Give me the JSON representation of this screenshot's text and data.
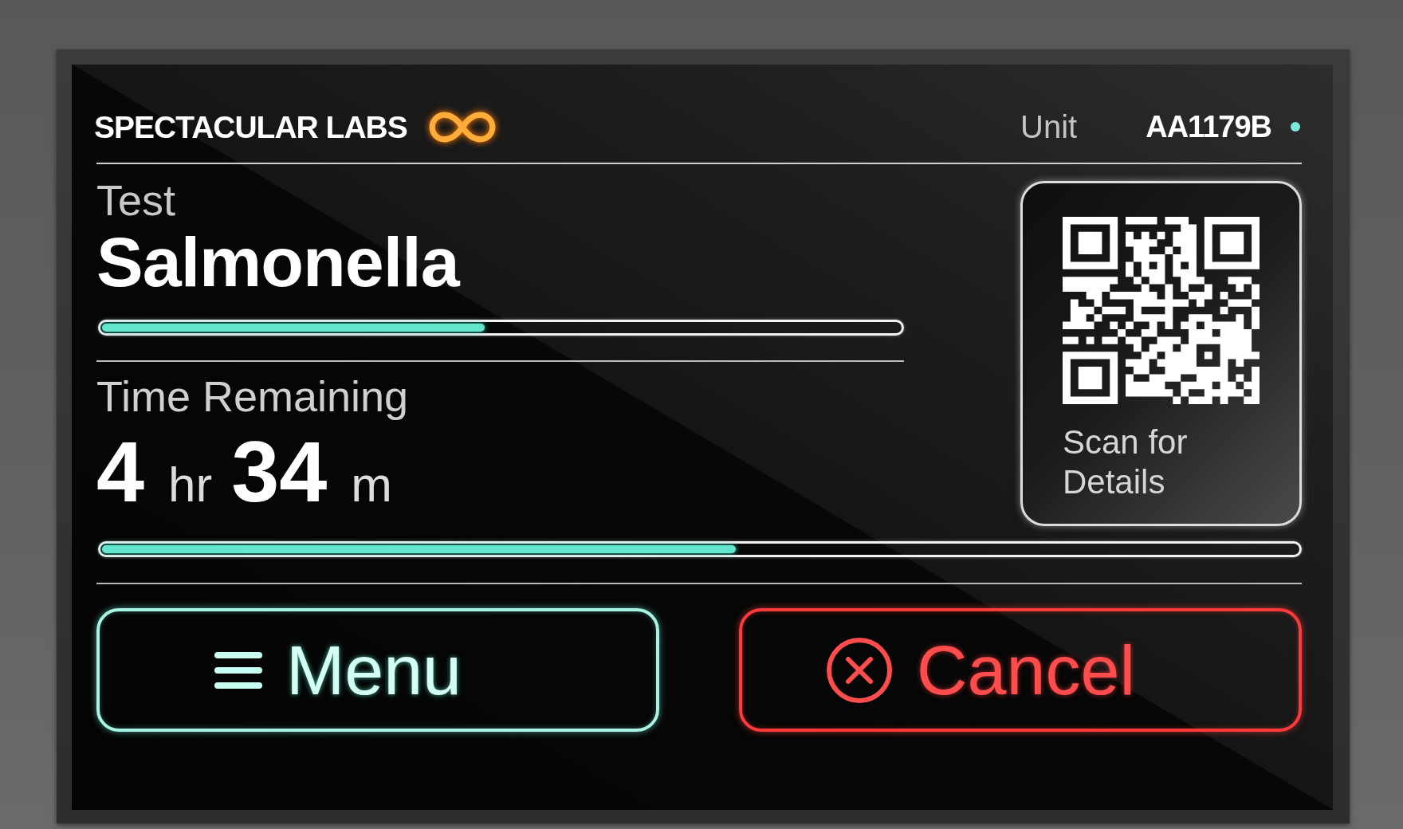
{
  "brand": {
    "name": "SPECTACULAR LABS"
  },
  "unit": {
    "label": "Unit",
    "value": "AA1179B"
  },
  "test": {
    "label": "Test",
    "name": "Salmonella",
    "progress": {
      "level": 0.48
    }
  },
  "time_remaining": {
    "label": "Time Remaining",
    "parts": [
      {
        "value": "4",
        "unit": "hr"
      },
      {
        "value": "34",
        "unit": "m"
      }
    ],
    "progress": {
      "level": 0.53
    }
  },
  "qr_card": {
    "caption": "Scan for Details"
  },
  "buttons": [
    {
      "kind": "menu",
      "label": "Menu"
    },
    {
      "kind": "cancel",
      "label": "Cancel"
    }
  ]
}
